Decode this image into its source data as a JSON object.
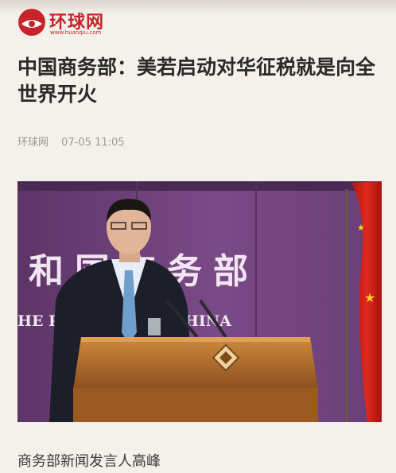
{
  "app": {
    "logo_text": "环球网",
    "logo_url": "www.huanqiu.com"
  },
  "article": {
    "headline": "中国商务部：美若启动对华征税就是向全世界开火",
    "source": "环球网",
    "timestamp": "07-05 11:05",
    "photo_backdrop_text": "和国商务部",
    "photo_backdrop_english": "HE PE       LIC OF CHINA",
    "caption": "商务部新闻发言人高峰"
  },
  "colors": {
    "brand_red": "#c8232a",
    "backdrop_purple": "#6b3f7a",
    "flag_red": "#d4231c",
    "podium": "#b8742f"
  },
  "icons": {
    "logo_mark": "globe-logo-icon",
    "podium_emblem": "commerce-emblem-icon"
  }
}
